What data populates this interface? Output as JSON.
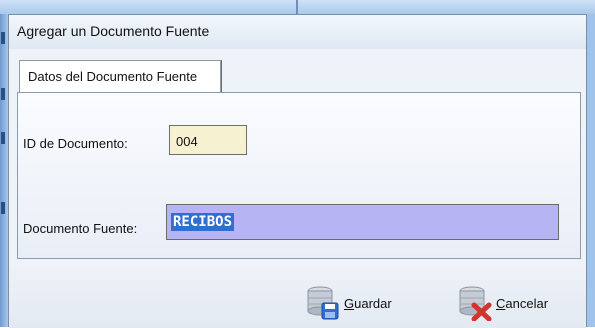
{
  "window": {
    "title": "Agregar un Documento Fuente"
  },
  "tabs": [
    {
      "label": "Datos del Documento Fuente"
    }
  ],
  "form": {
    "id_label": "ID de Documento:",
    "id_value": "004",
    "doc_label": "Documento Fuente:",
    "doc_value": "RECIBOS"
  },
  "buttons": {
    "save": {
      "label": "Guardar",
      "icon": "database-save-icon"
    },
    "cancel": {
      "label": "Cancelar",
      "icon": "database-delete-icon"
    }
  },
  "colors": {
    "frame": "#9fc3ea",
    "id_field_bg": "#f6f1d0",
    "doc_field_bg": "#b6b4f3",
    "selection": "#2f6fd0"
  }
}
